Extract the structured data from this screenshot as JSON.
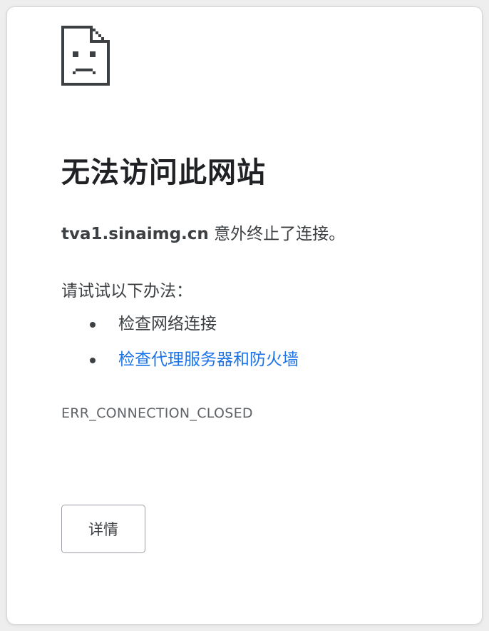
{
  "page": {
    "icon": "sad-document-icon",
    "title": "无法访问此网站",
    "message": {
      "host": "tva1.sinaimg.cn",
      "text": " 意外终止了连接。"
    },
    "suggestions_intro": "请试试以下办法：",
    "suggestions": [
      {
        "label": "检查网络连接",
        "is_link": false
      },
      {
        "label": "检查代理服务器和防火墙",
        "is_link": true
      }
    ],
    "error_code": "ERR_CONNECTION_CLOSED",
    "details_button_label": "详情"
  },
  "colors": {
    "text": "#202124",
    "secondary_text": "#3c4043",
    "link": "#1a73e8",
    "button_border": "#9aa0a6"
  }
}
